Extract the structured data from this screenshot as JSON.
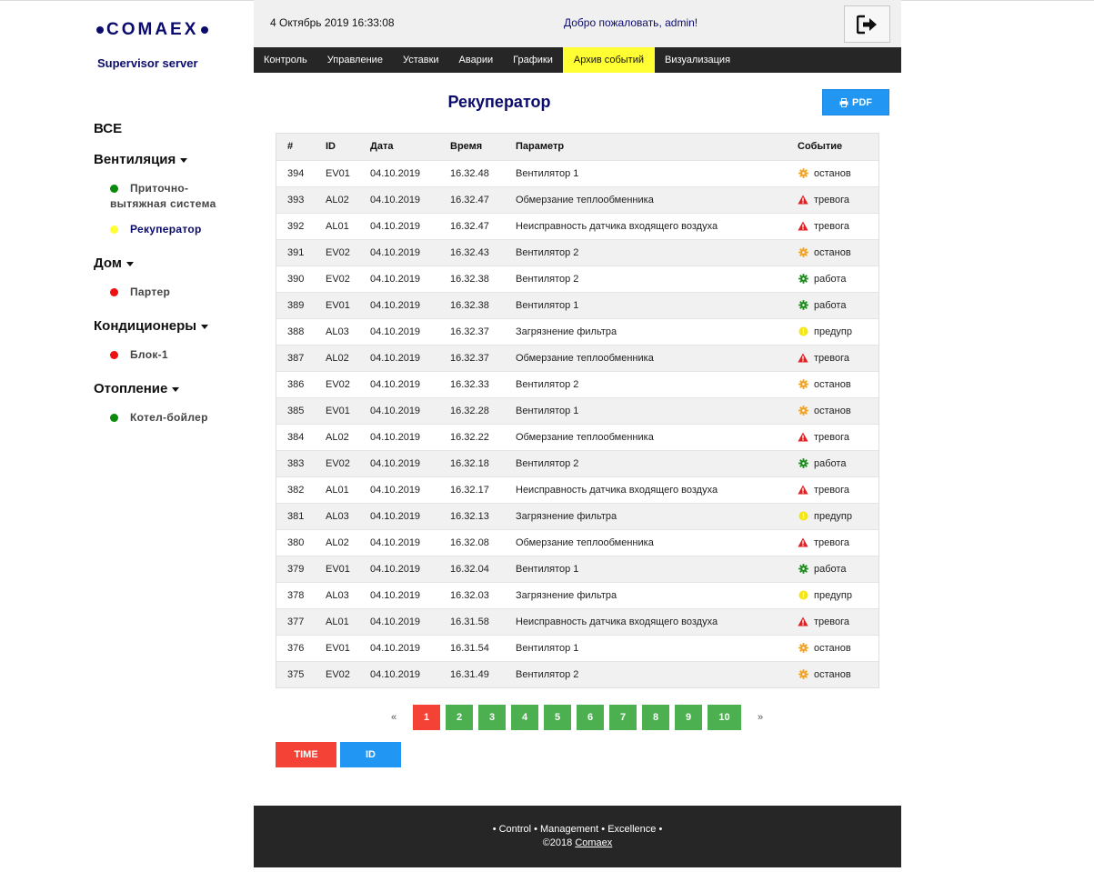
{
  "brand": {
    "logo_text": "COMAEX",
    "subtitle": "Supervisor server",
    "color": "#0b0b6e"
  },
  "header": {
    "datetime": "4 Октябрь 2019 16:33:08",
    "welcome": "Добро пожаловать, admin!",
    "logout_icon": "sign-out-icon"
  },
  "menu": {
    "items": [
      "Контроль",
      "Управление",
      "Уставки",
      "Аварии",
      "Графики",
      "Архив событий",
      "Визуализация"
    ],
    "active": "Архив событий",
    "active_color": "#ffff33"
  },
  "sidebar": {
    "all_label": "ВСЕ",
    "groups": [
      {
        "title": "Вентиляция",
        "items": [
          {
            "label_line1": "Приточно-",
            "label_line2": "вытяжная система",
            "status_color": "#0a8a0a"
          },
          {
            "label": "Рекуператор",
            "status_color": "#ffff33",
            "active": true
          }
        ]
      },
      {
        "title": "Дом",
        "items": [
          {
            "label": "Партер",
            "status_color": "#ee1111"
          }
        ]
      },
      {
        "title": "Кондиционеры",
        "items": [
          {
            "label": "Блок-1",
            "status_color": "#ee1111"
          }
        ]
      },
      {
        "title": "Отопление",
        "items": [
          {
            "label": "Котел-бойлер",
            "status_color": "#0a8a0a"
          }
        ]
      }
    ]
  },
  "page": {
    "title": "Рекуператор",
    "pdf_label": "PDF"
  },
  "table": {
    "headers": [
      "#",
      "ID",
      "Дата",
      "Время",
      "Параметр",
      "Событие"
    ],
    "rows": [
      {
        "n": "394",
        "id": "EV01",
        "date": "04.10.2019",
        "time": "16.32.48",
        "param": "Вентилятор 1",
        "event": "останов",
        "type": "stop"
      },
      {
        "n": "393",
        "id": "AL02",
        "date": "04.10.2019",
        "time": "16.32.47",
        "param": "Обмерзание теплообменника",
        "event": "тревога",
        "type": "alarm"
      },
      {
        "n": "392",
        "id": "AL01",
        "date": "04.10.2019",
        "time": "16.32.47",
        "param": "Неисправность датчика входящего воздуха",
        "event": "тревога",
        "type": "alarm"
      },
      {
        "n": "391",
        "id": "EV02",
        "date": "04.10.2019",
        "time": "16.32.43",
        "param": "Вентилятор 2",
        "event": "останов",
        "type": "stop"
      },
      {
        "n": "390",
        "id": "EV02",
        "date": "04.10.2019",
        "time": "16.32.38",
        "param": "Вентилятор 2",
        "event": "работа",
        "type": "run"
      },
      {
        "n": "389",
        "id": "EV01",
        "date": "04.10.2019",
        "time": "16.32.38",
        "param": "Вентилятор 1",
        "event": "работа",
        "type": "run"
      },
      {
        "n": "388",
        "id": "AL03",
        "date": "04.10.2019",
        "time": "16.32.37",
        "param": "Загрязнение фильтра",
        "event": "предупр",
        "type": "warn"
      },
      {
        "n": "387",
        "id": "AL02",
        "date": "04.10.2019",
        "time": "16.32.37",
        "param": "Обмерзание теплообменника",
        "event": "тревога",
        "type": "alarm"
      },
      {
        "n": "386",
        "id": "EV02",
        "date": "04.10.2019",
        "time": "16.32.33",
        "param": "Вентилятор 2",
        "event": "останов",
        "type": "stop"
      },
      {
        "n": "385",
        "id": "EV01",
        "date": "04.10.2019",
        "time": "16.32.28",
        "param": "Вентилятор 1",
        "event": "останов",
        "type": "stop"
      },
      {
        "n": "384",
        "id": "AL02",
        "date": "04.10.2019",
        "time": "16.32.22",
        "param": "Обмерзание теплообменника",
        "event": "тревога",
        "type": "alarm"
      },
      {
        "n": "383",
        "id": "EV02",
        "date": "04.10.2019",
        "time": "16.32.18",
        "param": "Вентилятор 2",
        "event": "работа",
        "type": "run"
      },
      {
        "n": "382",
        "id": "AL01",
        "date": "04.10.2019",
        "time": "16.32.17",
        "param": "Неисправность датчика входящего воздуха",
        "event": "тревога",
        "type": "alarm"
      },
      {
        "n": "381",
        "id": "AL03",
        "date": "04.10.2019",
        "time": "16.32.13",
        "param": "Загрязнение фильтра",
        "event": "предупр",
        "type": "warn"
      },
      {
        "n": "380",
        "id": "AL02",
        "date": "04.10.2019",
        "time": "16.32.08",
        "param": "Обмерзание теплообменника",
        "event": "тревога",
        "type": "alarm"
      },
      {
        "n": "379",
        "id": "EV01",
        "date": "04.10.2019",
        "time": "16.32.04",
        "param": "Вентилятор 1",
        "event": "работа",
        "type": "run"
      },
      {
        "n": "378",
        "id": "AL03",
        "date": "04.10.2019",
        "time": "16.32.03",
        "param": "Загрязнение фильтра",
        "event": "предупр",
        "type": "warn"
      },
      {
        "n": "377",
        "id": "AL01",
        "date": "04.10.2019",
        "time": "16.31.58",
        "param": "Неисправность датчика входящего воздуха",
        "event": "тревога",
        "type": "alarm"
      },
      {
        "n": "376",
        "id": "EV01",
        "date": "04.10.2019",
        "time": "16.31.54",
        "param": "Вентилятор 1",
        "event": "останов",
        "type": "stop"
      },
      {
        "n": "375",
        "id": "EV02",
        "date": "04.10.2019",
        "time": "16.31.49",
        "param": "Вентилятор 2",
        "event": "останов",
        "type": "stop"
      }
    ],
    "event_icons": {
      "stop": {
        "icon": "gear-icon",
        "color": "#f0a020"
      },
      "run": {
        "icon": "gear-icon",
        "color": "#1a8a1a"
      },
      "alarm": {
        "icon": "warning-triangle-icon",
        "color": "#e02020"
      },
      "warn": {
        "icon": "exclamation-circle-icon",
        "color": "#f5e611"
      }
    }
  },
  "pagination": {
    "prev": "«",
    "next": "»",
    "pages": [
      "1",
      "2",
      "3",
      "4",
      "5",
      "6",
      "7",
      "8",
      "9",
      "10"
    ],
    "current": "1",
    "page_color": "#4caf50",
    "current_color": "#f44336"
  },
  "sort": {
    "time_label": "TIME",
    "id_label": "ID"
  },
  "footer": {
    "slogan": "• Control • Management • Excellence •",
    "copyright": "©2018",
    "company": "Comaex"
  }
}
